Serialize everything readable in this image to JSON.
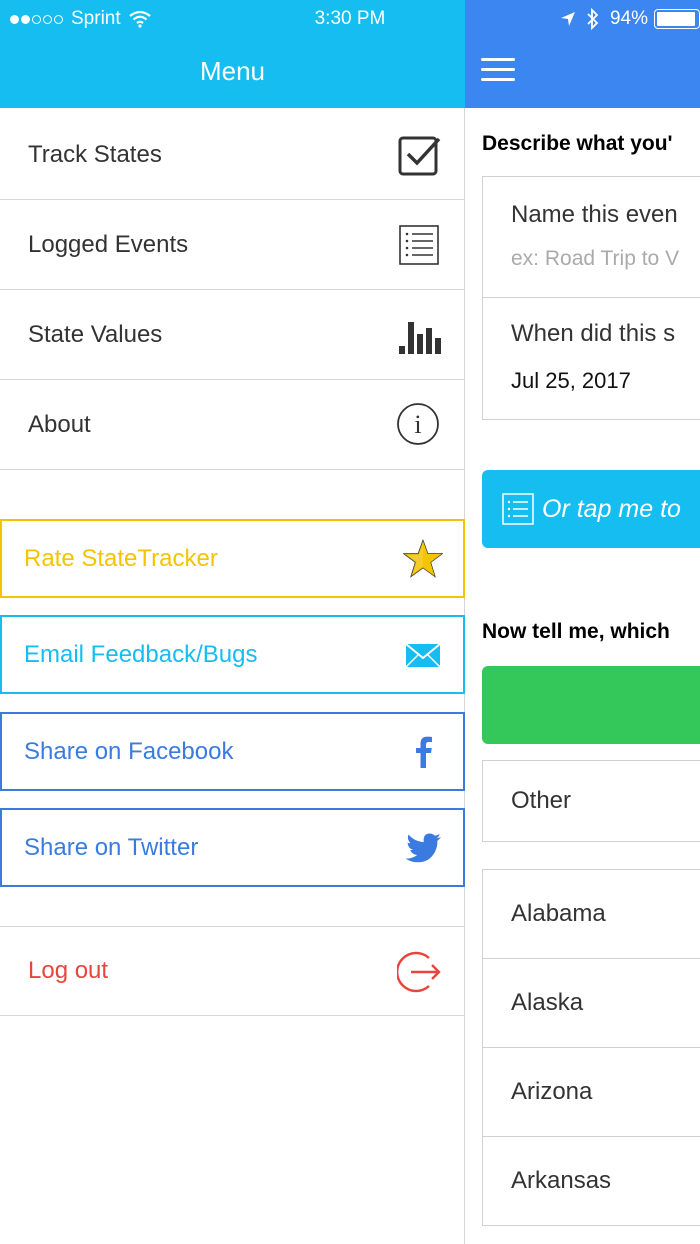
{
  "status_bar": {
    "carrier": "Sprint",
    "time": "3:30 PM",
    "battery": "94%"
  },
  "menu": {
    "title": "Menu",
    "items": [
      {
        "label": "Track States",
        "icon": "checkbox-icon"
      },
      {
        "label": "Logged Events",
        "icon": "list-icon"
      },
      {
        "label": "State Values",
        "icon": "bar-chart-icon"
      },
      {
        "label": "About",
        "icon": "info-icon"
      }
    ],
    "actions": [
      {
        "label": "Rate StateTracker",
        "icon": "star-icon",
        "color": "#f5c400"
      },
      {
        "label": "Email Feedback/Bugs",
        "icon": "envelope-icon",
        "color": "#15bdf0"
      },
      {
        "label": "Share on Facebook",
        "icon": "facebook-icon",
        "color": "#3b7be0"
      },
      {
        "label": "Share on Twitter",
        "icon": "twitter-icon",
        "color": "#3b7be0"
      }
    ],
    "logout": {
      "label": "Log out",
      "icon": "logout-icon",
      "color": "#e8453c"
    }
  },
  "main": {
    "describe_title": "Describe what you'",
    "name_label": "Name this even",
    "name_placeholder": "ex: Road Trip to V",
    "when_label": "When did this s",
    "when_value": "Jul 25, 2017",
    "tap_button": "Or tap me to",
    "states_title": "Now tell me, which",
    "other_label": "Other",
    "states": [
      "Alabama",
      "Alaska",
      "Arizona",
      "Arkansas"
    ]
  },
  "colors": {
    "menu_header": "#15bdf0",
    "main_header": "#3b86f0",
    "green_button": "#34c759"
  }
}
